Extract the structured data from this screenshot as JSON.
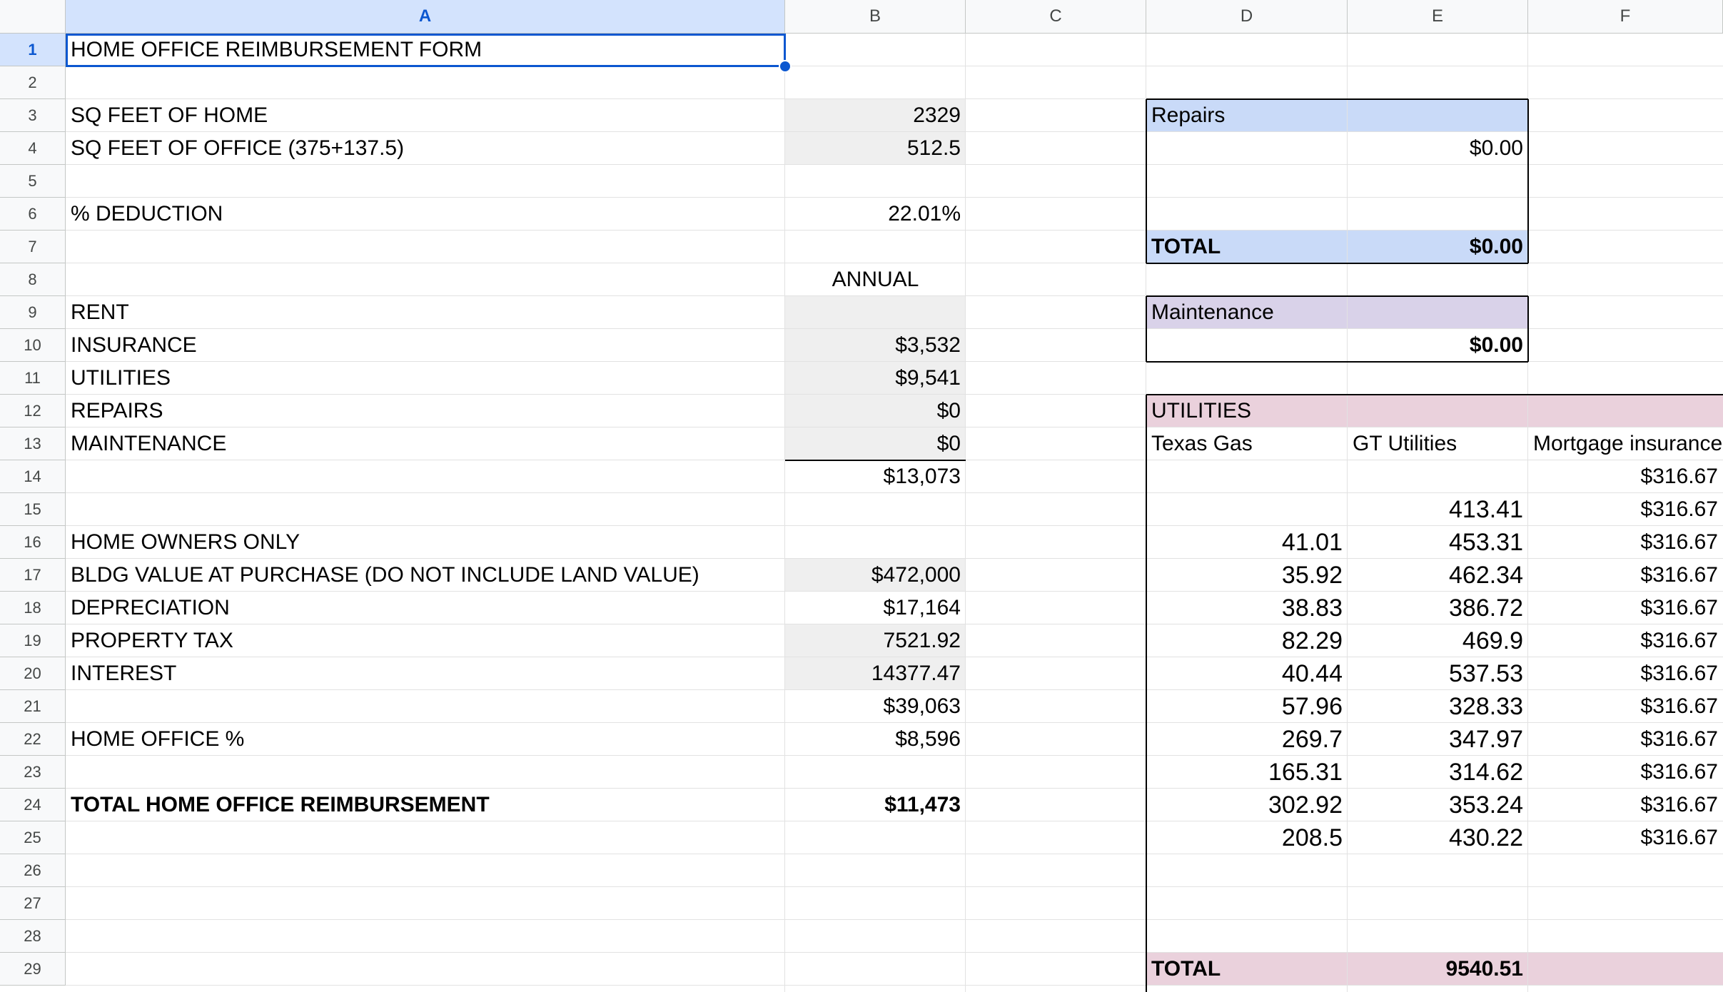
{
  "columns": [
    "A",
    "B",
    "C",
    "D",
    "E",
    "F"
  ],
  "rows": [
    "1",
    "2",
    "3",
    "4",
    "5",
    "6",
    "7",
    "8",
    "9",
    "10",
    "11",
    "12",
    "13",
    "14",
    "15",
    "16",
    "17",
    "18",
    "19",
    "20",
    "21",
    "22",
    "23",
    "24",
    "25",
    "26",
    "27",
    "28",
    "29"
  ],
  "selection": {
    "cell": "A1",
    "column": "A",
    "row": "1"
  },
  "colors": {
    "selection": "#0b57d0",
    "header_selected": "#d3e3fd",
    "input_gray": "#efefef",
    "repairs_blue": "#c9daf8",
    "maintenance_purple": "#d9d2e9",
    "utilities_pink": "#ead1dc"
  },
  "cells": {
    "A1": "HOME OFFICE REIMBURSEMENT FORM",
    "A3": "SQ FEET OF HOME",
    "B3": "2329",
    "A4": "SQ FEET OF OFFICE (375+137.5)",
    "B4": "512.5",
    "A6": "% DEDUCTION",
    "B6": "22.01%",
    "B8": "ANNUAL",
    "A9": "RENT",
    "A10": "INSURANCE",
    "B10": "$3,532",
    "A11": "UTILITIES",
    "B11": "$9,541",
    "A12": "REPAIRS",
    "B12": "$0",
    "A13": "MAINTENANCE",
    "B13": "$0",
    "B14": "$13,073",
    "A16": "HOME OWNERS ONLY",
    "A17": "BLDG VALUE AT PURCHASE (DO NOT INCLUDE LAND VALUE)",
    "B17": "$472,000",
    "A18": "DEPRECIATION",
    "B18": "$17,164",
    "A19": "PROPERTY TAX",
    "B19": "7521.92",
    "A20": "INTEREST",
    "B20": "14377.47",
    "B21": "$39,063",
    "A22": "HOME OFFICE %",
    "B22": "$8,596",
    "A24": "TOTAL HOME OFFICE REIMBURSEMENT",
    "B24": "$11,473",
    "D3": "Repairs",
    "E4": "$0.00",
    "D7": "TOTAL",
    "E7": "$0.00",
    "D9": "Maintenance",
    "E10": "$0.00",
    "D12": "UTILITIES",
    "D13": "Texas Gas",
    "E13": "GT Utilities",
    "F13": "Mortgage insurance",
    "F14": "$316.67",
    "E15": "413.41",
    "F15": "$316.67",
    "D16": "41.01",
    "E16": "453.31",
    "F16": "$316.67",
    "D17": "35.92",
    "E17": "462.34",
    "F17": "$316.67",
    "D18": "38.83",
    "E18": "386.72",
    "F18": "$316.67",
    "D19": "82.29",
    "E19": "469.9",
    "F19": "$316.67",
    "D20": "40.44",
    "E20": "537.53",
    "F20": "$316.67",
    "D21": "57.96",
    "E21": "328.33",
    "F21": "$316.67",
    "D22": "269.7",
    "E22": "347.97",
    "F22": "$316.67",
    "D23": "165.31",
    "E23": "314.62",
    "F23": "$316.67",
    "D24": "302.92",
    "E24": "353.24",
    "F24": "$316.67",
    "D25": "208.5",
    "E25": "430.22",
    "F25": "$316.67",
    "D29": "TOTAL",
    "E29": "9540.51"
  }
}
